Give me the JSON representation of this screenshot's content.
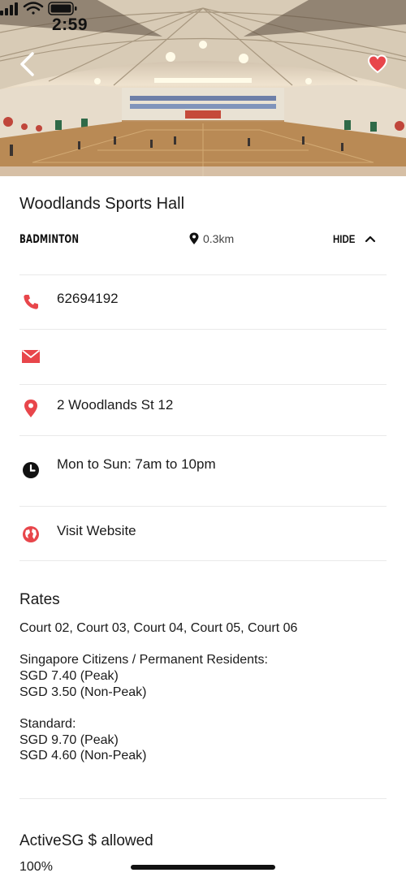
{
  "status_bar": {
    "time": "2:59"
  },
  "header": {
    "back_icon": "chevron-left-icon",
    "favorite_icon": "heart-icon",
    "favorite_color": "#e8464b"
  },
  "venue": {
    "name": "Woodlands Sports Hall",
    "category": "BADMINTON",
    "distance": "0.3km",
    "hide_label": "HIDE"
  },
  "contact": {
    "phone": "62694192",
    "email": "",
    "address": "2 Woodlands St 12",
    "hours": "Mon to Sun: 7am to 10pm",
    "website_label": "Visit Website"
  },
  "rates": {
    "title": "Rates",
    "courts": "Court 02, Court 03, Court 04, Court 05, Court 06",
    "citizens_heading": "Singapore Citizens / Permanent Residents:",
    "citizens_peak": "SGD 7.40 (Peak)",
    "citizens_offpeak": "SGD 3.50 (Non-Peak)",
    "standard_heading": "Standard:",
    "standard_peak": "SGD 9.70 (Peak)",
    "standard_offpeak": "SGD 4.60 (Non-Peak)"
  },
  "activesg": {
    "title": "ActiveSG $ allowed",
    "value": "100%"
  },
  "colors": {
    "accent": "#e8464b",
    "text": "#1a1a1a",
    "divider": "#e9e9e9"
  }
}
